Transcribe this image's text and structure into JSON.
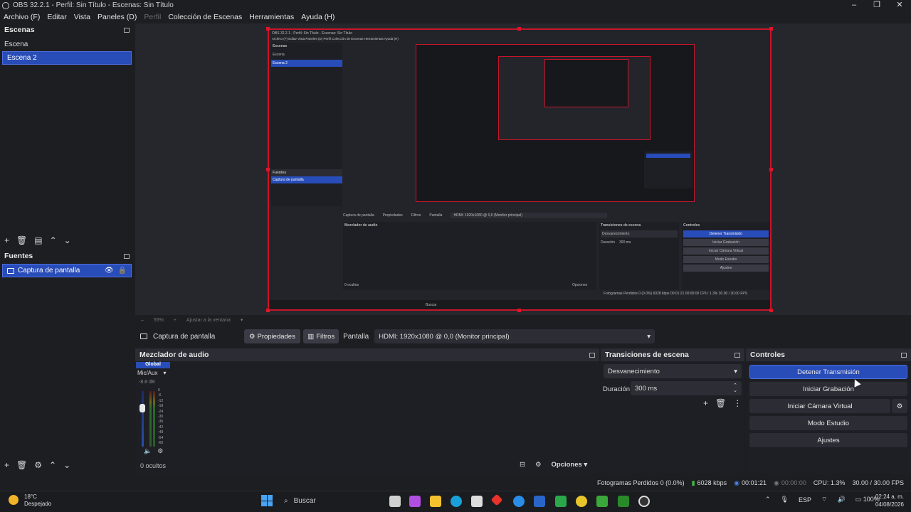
{
  "window": {
    "title": "OBS 32.2.1 - Perfil: Sin Título - Escenas: Sin Título"
  },
  "menu": [
    {
      "label": "Archivo (F)",
      "dim": false
    },
    {
      "label": "Editar",
      "dim": false
    },
    {
      "label": "Vista",
      "dim": false
    },
    {
      "label": "Paneles (D)",
      "dim": false
    },
    {
      "label": "Perfil",
      "dim": true
    },
    {
      "label": "Colección de Escenas",
      "dim": false
    },
    {
      "label": "Herramientas",
      "dim": false
    },
    {
      "label": "Ayuda (H)",
      "dim": false
    }
  ],
  "scenes": {
    "title": "Escenas",
    "items": [
      "Escena",
      "Escena 2"
    ],
    "selected_index": 1
  },
  "sources": {
    "title": "Fuentes",
    "items": [
      {
        "label": "Captura de pantalla"
      }
    ]
  },
  "nested_preview": {
    "title": "OBS 32.2.1 - Perfil: Sin Título - Escenas: Sin Título",
    "menu": "Archivo (F)   Editar   Vista   Paneles (D)   Perfil   Colección de Escenas   Herramientas   Ayuda (H)",
    "scenes_title": "Escenas",
    "scene_items": [
      "Escena",
      "Escena 2"
    ],
    "sources_title": "Fuentes",
    "source_item": "Captura de pantalla",
    "source_label": "Captura de pantalla",
    "props": "Propiedades",
    "filters": "Filtros",
    "display": "Pantalla",
    "display_value": "HDMI: 1920x1080 @ 0,0 (Monitor principal)",
    "mixer": "Mezclador de audio",
    "transitions": "Transiciones de escena",
    "fade": "Desvanecimiento",
    "duration": "Duración",
    "duration_value": "300 ms",
    "controls": "Controles",
    "buttons": [
      "Detener Transmisión",
      "Iniciar Grabación",
      "Iniciar Cámara Virtual",
      "Modo Estudio",
      "Ajustes"
    ],
    "hidden": "0 ocultos",
    "options": "Opciones",
    "status": "Fotogramas Perdidos 0 (0.0%)   6028 kbps   00:01:21   00:00:00   CPU: 1.3%   30.00 / 30.00 FPS",
    "search": "Buscar"
  },
  "zoom": {
    "percent": "55%",
    "fit": "Ajustar a la ventana"
  },
  "source_bar": {
    "source_name": "Captura de pantalla",
    "properties": "Propiedades",
    "filters": "Filtros",
    "display_label": "Pantalla",
    "display_value": "HDMI: 1920x1080 @ 0,0 (Monitor principal)"
  },
  "mixer": {
    "title": "Mezclador de audio",
    "channel_tab": "Global",
    "channel_name": "Mic/Aux",
    "db_value": "-8.8 dB",
    "scale": [
      "0",
      "-6",
      "-12",
      "-18",
      "-24",
      "-30",
      "-36",
      "-42",
      "-48",
      "-54",
      "-60"
    ],
    "hidden_count": "0 ocultos",
    "options": "Opciones"
  },
  "transitions": {
    "title": "Transiciones de escena",
    "selected": "Desvanecimiento",
    "duration_label": "Duración",
    "duration_value": "300 ms"
  },
  "controls": {
    "title": "Controles",
    "stop_stream": "Detener Transmisión",
    "start_recording": "Iniciar Grabación",
    "start_virtualcam": "Iniciar Cámara Virtual",
    "studio_mode": "Modo Estudio",
    "settings": "Ajustes"
  },
  "status": {
    "dropped": "Fotogramas Perdidos 0 (0.0%)",
    "bitrate": "6028 kbps",
    "stream_time": "00:01:21",
    "rec_time": "00:00:00",
    "cpu": "CPU: 1.3%",
    "fps": "30.00 / 30.00 FPS"
  },
  "taskbar": {
    "weather_temp": "18°C",
    "weather_desc": "Despejado",
    "search": "Buscar",
    "lang": "ESP",
    "battery": "100%",
    "time": "02:24 a. m.",
    "date": "04/08/2026"
  },
  "colors": {
    "accent": "#284cb8",
    "record_border": "#c8142a",
    "background": "#1d1e22"
  }
}
